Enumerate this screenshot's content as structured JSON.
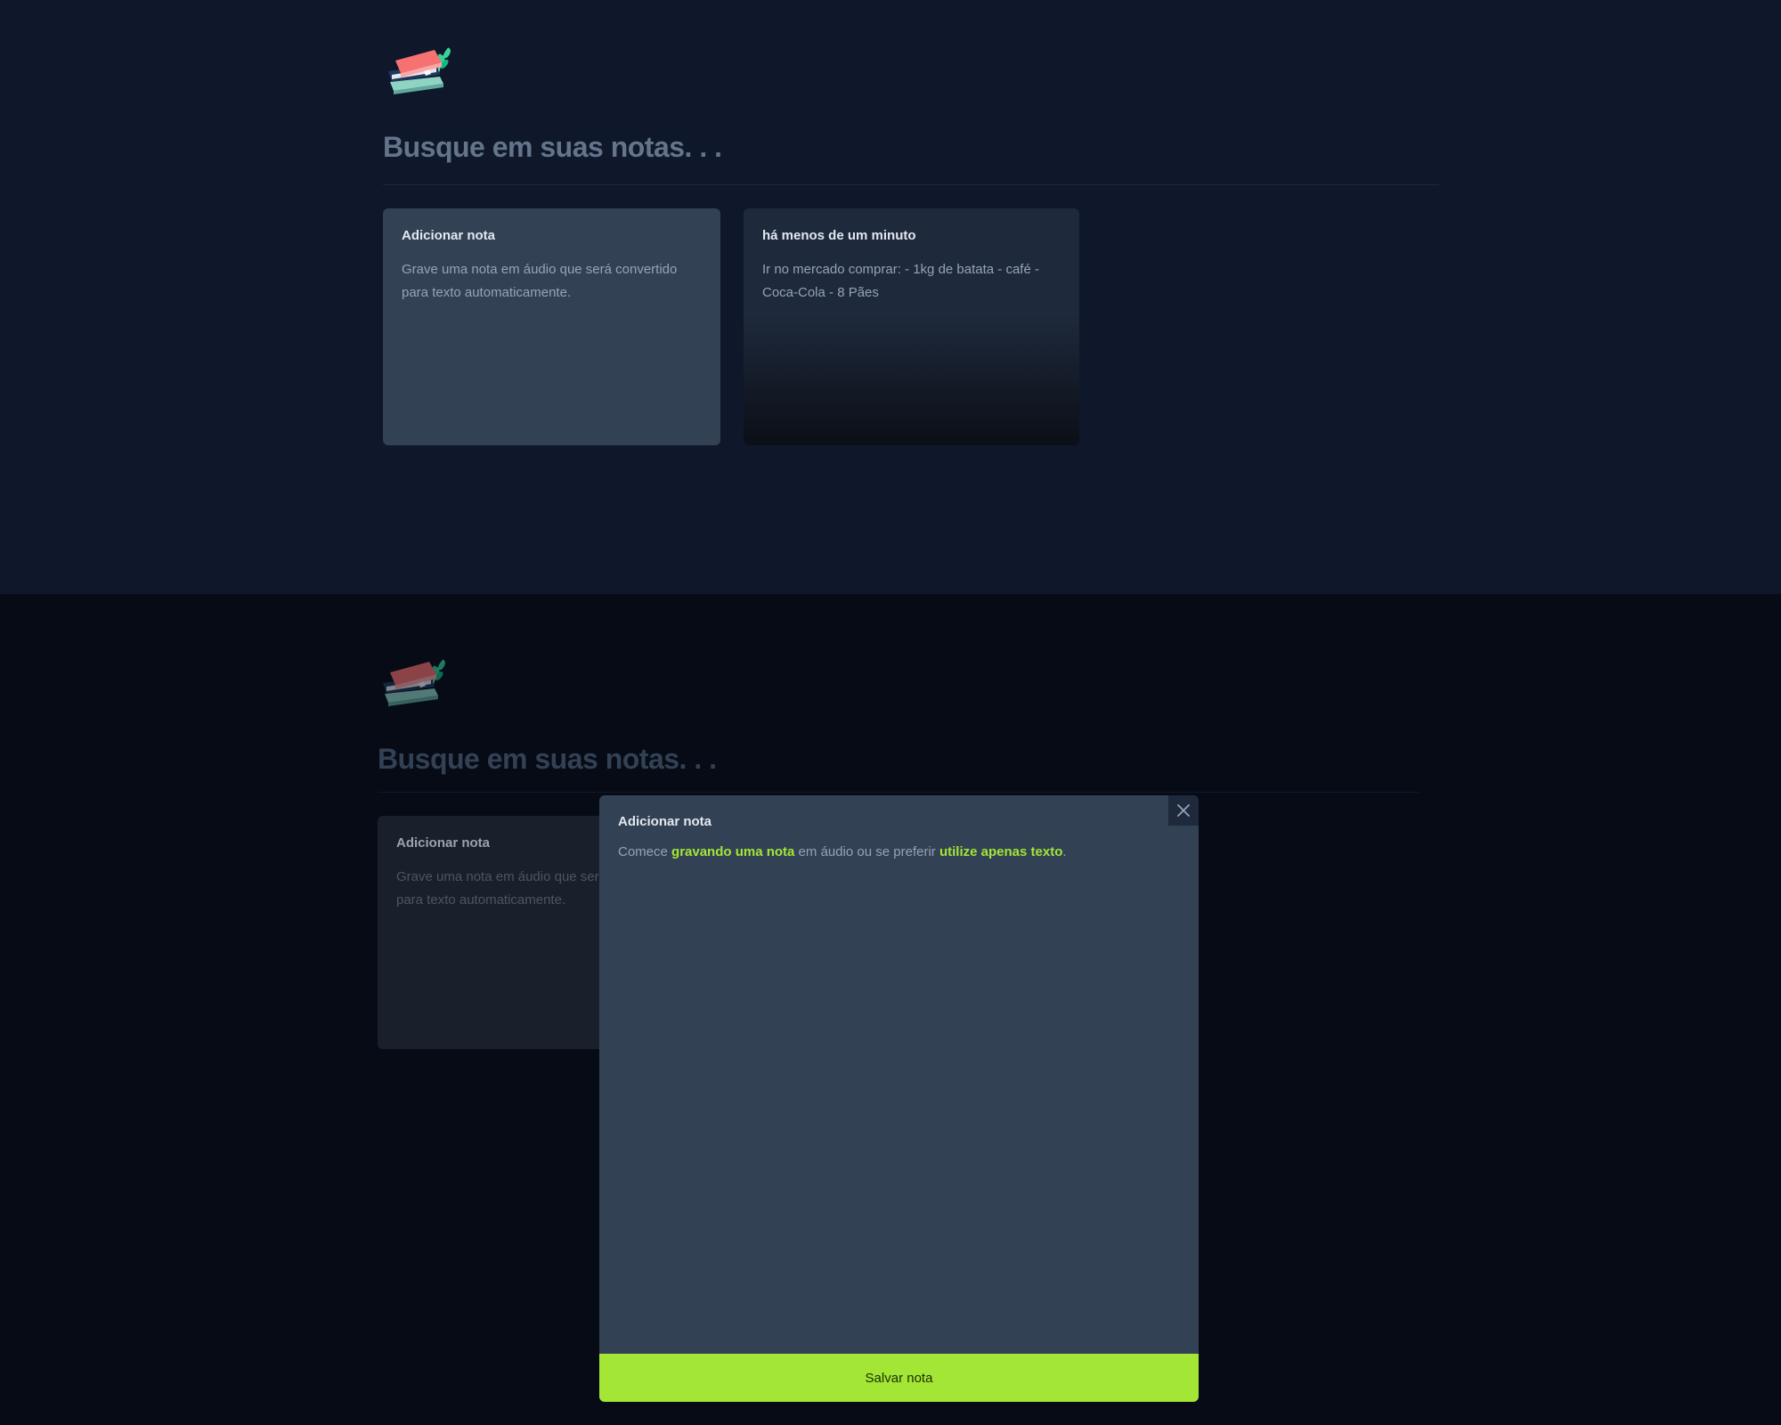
{
  "app": {
    "logo_icon": "books-with-leaves-icon",
    "accent_color": "#a3e635"
  },
  "search": {
    "placeholder": "Busque em suas notas. . ."
  },
  "cards": {
    "add": {
      "title": "Adicionar nota",
      "description": "Grave uma nota em áudio que será convertido para texto automaticamente."
    },
    "note": {
      "date": "há menos de um minuto",
      "content": "Ir no mercado comprar: - 1kg de batata - café - Coca-Cola - 8 Pães"
    }
  },
  "modal": {
    "title": "Adicionar nota",
    "text_start": "Comece ",
    "link_record": "gravando uma nota",
    "text_middle": " em áudio ou se preferir ",
    "link_text": "utilize apenas texto",
    "text_end": ".",
    "close_icon": "close-icon",
    "save_label": "Salvar nota"
  }
}
